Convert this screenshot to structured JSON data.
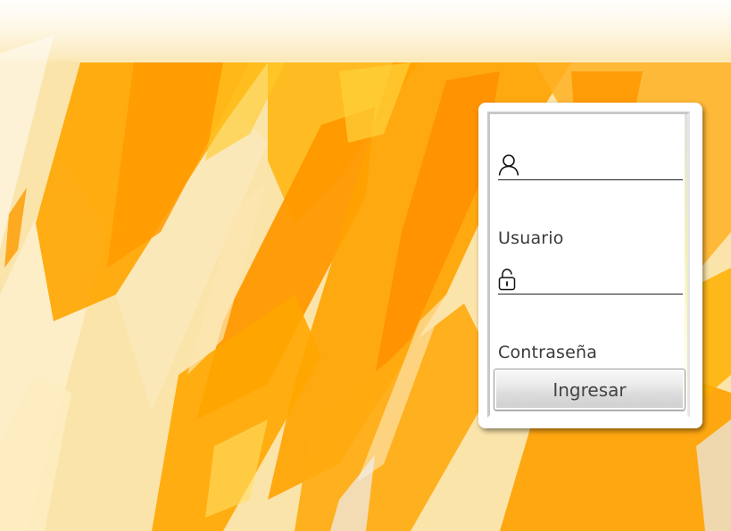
{
  "login": {
    "username": {
      "label": "Usuario",
      "value": "",
      "icon": "user-icon"
    },
    "password": {
      "label": "Contraseña",
      "value": "",
      "icon": "lock-icon"
    },
    "submit_label": "Ingresar"
  },
  "colors": {
    "paint_orange": "#ff9f00",
    "paint_light": "#fbe3a6",
    "card_bg": "#ffffff",
    "text": "#3a3a3a"
  }
}
